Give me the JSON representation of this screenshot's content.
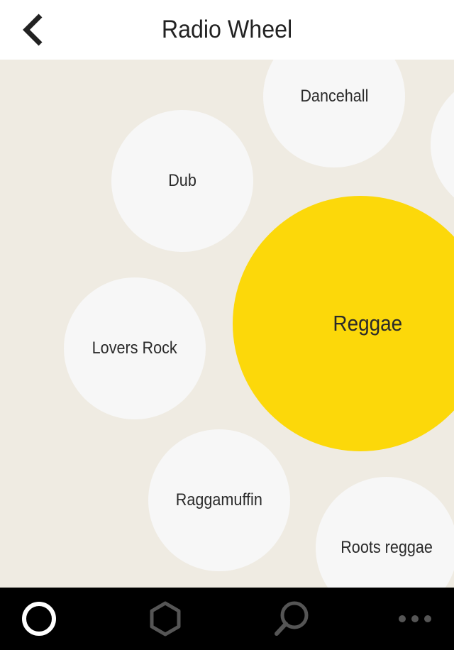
{
  "header": {
    "title": "Radio Wheel",
    "back_icon": "chevron-left-icon"
  },
  "wheel": {
    "bubbles": [
      {
        "label": "Dancehall",
        "selected": false
      },
      {
        "label": "Dub",
        "selected": false
      },
      {
        "label": "Reggae",
        "selected": true
      },
      {
        "label": "Lovers Rock",
        "selected": false
      },
      {
        "label": "Raggamuffin",
        "selected": false
      },
      {
        "label": "Roots reggae",
        "selected": false
      },
      {
        "label": "",
        "selected": false
      }
    ]
  },
  "tabbar": {
    "tabs": [
      {
        "icon": "circle-icon",
        "active": true
      },
      {
        "icon": "hexagon-icon",
        "active": false
      },
      {
        "icon": "search-icon",
        "active": false
      },
      {
        "icon": "more-icon",
        "active": false
      }
    ]
  },
  "colors": {
    "background": "#efebe2",
    "bubble": "#f7f7f7",
    "selected": "#fcd80a",
    "tabbar": "#000000",
    "icon_active": "#ffffff",
    "icon_inactive": "#555555"
  }
}
